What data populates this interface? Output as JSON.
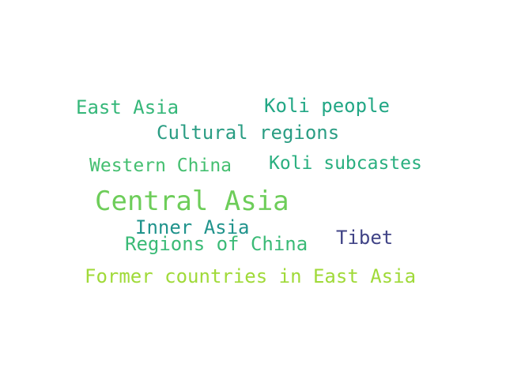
{
  "words": [
    {
      "id": "central",
      "text": "Central Asia",
      "color": "#6dcd59"
    },
    {
      "id": "cultural",
      "text": "Cultural regions",
      "color": "#2a9d83"
    },
    {
      "id": "koli_people",
      "text": "Koli people",
      "color": "#22a785"
    },
    {
      "id": "east_asia",
      "text": "East Asia",
      "color": "#35b779"
    },
    {
      "id": "koli_subcastes",
      "text": "Koli subcastes",
      "color": "#29af7f"
    },
    {
      "id": "western_china",
      "text": "Western China",
      "color": "#44bf70"
    },
    {
      "id": "inner_asia",
      "text": "Inner Asia",
      "color": "#20938c"
    },
    {
      "id": "regions_china",
      "text": "Regions of China",
      "color": "#3aba76"
    },
    {
      "id": "tibet",
      "text": "Tibet",
      "color": "#414487"
    },
    {
      "id": "former",
      "text": "Former countries in East Asia",
      "color": "#a0da39"
    }
  ]
}
